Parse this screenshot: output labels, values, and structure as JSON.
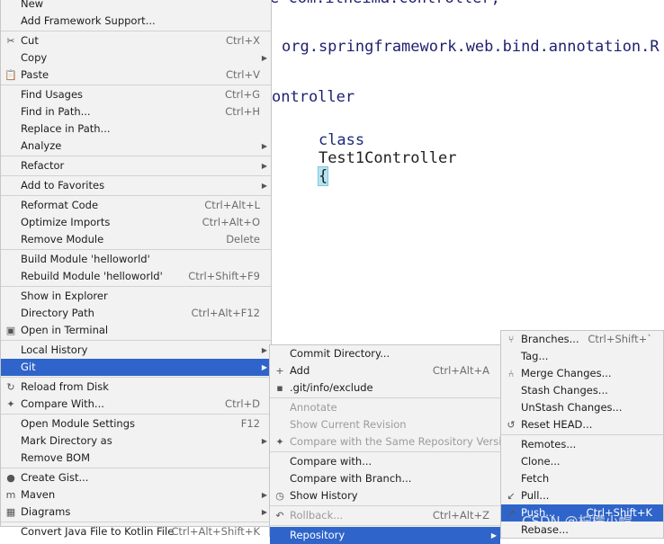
{
  "editor": {
    "line0": "e com.itheima.controller;",
    "line1": "org.springframework.web.bind.annotation.R",
    "line2": "ontroller",
    "line3_kw": "class",
    "line3_name": "Test1Controller",
    "line3_brace": "{"
  },
  "menu1": {
    "items": [
      {
        "label": "New",
        "shortcut": "",
        "arrow": "",
        "icon": ""
      },
      {
        "label": "Add Framework Support...",
        "shortcut": "",
        "arrow": "",
        "icon": ""
      },
      {
        "label": "Cut",
        "shortcut": "Ctrl+X",
        "arrow": "",
        "icon": "✂"
      },
      {
        "label": "Copy",
        "shortcut": "",
        "arrow": "▶",
        "icon": ""
      },
      {
        "label": "Paste",
        "shortcut": "Ctrl+V",
        "arrow": "",
        "icon": "📋"
      },
      {
        "label": "Find Usages",
        "shortcut": "Ctrl+G",
        "arrow": "",
        "icon": ""
      },
      {
        "label": "Find in Path...",
        "shortcut": "Ctrl+H",
        "arrow": "",
        "icon": ""
      },
      {
        "label": "Replace in Path...",
        "shortcut": "",
        "arrow": "",
        "icon": ""
      },
      {
        "label": "Analyze",
        "shortcut": "",
        "arrow": "▶",
        "icon": ""
      },
      {
        "label": "Refactor",
        "shortcut": "",
        "arrow": "▶",
        "icon": ""
      },
      {
        "label": "Add to Favorites",
        "shortcut": "",
        "arrow": "▶",
        "icon": ""
      },
      {
        "label": "Reformat Code",
        "shortcut": "Ctrl+Alt+L",
        "arrow": "",
        "icon": ""
      },
      {
        "label": "Optimize Imports",
        "shortcut": "Ctrl+Alt+O",
        "arrow": "",
        "icon": ""
      },
      {
        "label": "Remove Module",
        "shortcut": "Delete",
        "arrow": "",
        "icon": ""
      },
      {
        "label": "Build Module 'helloworld'",
        "shortcut": "",
        "arrow": "",
        "icon": ""
      },
      {
        "label": "Rebuild Module 'helloworld'",
        "shortcut": "Ctrl+Shift+F9",
        "arrow": "",
        "icon": ""
      },
      {
        "label": "Show in Explorer",
        "shortcut": "",
        "arrow": "",
        "icon": ""
      },
      {
        "label": "Directory Path",
        "shortcut": "Ctrl+Alt+F12",
        "arrow": "",
        "icon": ""
      },
      {
        "label": "Open in Terminal",
        "shortcut": "",
        "arrow": "",
        "icon": "▣"
      },
      {
        "label": "Local History",
        "shortcut": "",
        "arrow": "▶",
        "icon": ""
      },
      {
        "label": "Git",
        "shortcut": "",
        "arrow": "▶",
        "icon": ""
      },
      {
        "label": "Reload from Disk",
        "shortcut": "",
        "arrow": "",
        "icon": "↻"
      },
      {
        "label": "Compare With...",
        "shortcut": "Ctrl+D",
        "arrow": "",
        "icon": "✦"
      },
      {
        "label": "Open Module Settings",
        "shortcut": "F12",
        "arrow": "",
        "icon": ""
      },
      {
        "label": "Mark Directory as",
        "shortcut": "",
        "arrow": "▶",
        "icon": ""
      },
      {
        "label": "Remove BOM",
        "shortcut": "",
        "arrow": "",
        "icon": ""
      },
      {
        "label": "Create Gist...",
        "shortcut": "",
        "arrow": "",
        "icon": "●"
      },
      {
        "label": "Maven",
        "shortcut": "",
        "arrow": "▶",
        "icon": "m"
      },
      {
        "label": "Diagrams",
        "shortcut": "",
        "arrow": "▶",
        "icon": "▦"
      },
      {
        "label": "Convert Java File to Kotlin File",
        "shortcut": "Ctrl+Alt+Shift+K",
        "arrow": "",
        "icon": ""
      }
    ]
  },
  "menu2": {
    "items": [
      {
        "label": "Commit Directory...",
        "shortcut": "",
        "arrow": "",
        "icon": ""
      },
      {
        "label": "Add",
        "shortcut": "Ctrl+Alt+A",
        "arrow": "",
        "icon": "+"
      },
      {
        "label": ".git/info/exclude",
        "shortcut": "",
        "arrow": "",
        "icon": "▪"
      },
      {
        "label": "Annotate",
        "shortcut": "",
        "arrow": "",
        "icon": ""
      },
      {
        "label": "Show Current Revision",
        "shortcut": "",
        "arrow": "",
        "icon": ""
      },
      {
        "label": "Compare with the Same Repository Version",
        "shortcut": "",
        "arrow": "",
        "icon": "✦"
      },
      {
        "label": "Compare with...",
        "shortcut": "",
        "arrow": "",
        "icon": ""
      },
      {
        "label": "Compare with Branch...",
        "shortcut": "",
        "arrow": "",
        "icon": ""
      },
      {
        "label": "Show History",
        "shortcut": "",
        "arrow": "",
        "icon": "◷"
      },
      {
        "label": "Rollback...",
        "shortcut": "Ctrl+Alt+Z",
        "arrow": "",
        "icon": "↶"
      },
      {
        "label": "Repository",
        "shortcut": "",
        "arrow": "▶",
        "icon": ""
      }
    ]
  },
  "menu3": {
    "items": [
      {
        "label": "Branches...",
        "shortcut": "Ctrl+Shift+`",
        "arrow": "",
        "icon": "⑂"
      },
      {
        "label": "Tag...",
        "shortcut": "",
        "arrow": "",
        "icon": ""
      },
      {
        "label": "Merge Changes...",
        "shortcut": "",
        "arrow": "",
        "icon": "⑃"
      },
      {
        "label": "Stash Changes...",
        "shortcut": "",
        "arrow": "",
        "icon": ""
      },
      {
        "label": "UnStash Changes...",
        "shortcut": "",
        "arrow": "",
        "icon": ""
      },
      {
        "label": "Reset HEAD...",
        "shortcut": "",
        "arrow": "",
        "icon": "↺"
      },
      {
        "label": "Remotes...",
        "shortcut": "",
        "arrow": "",
        "icon": ""
      },
      {
        "label": "Clone...",
        "shortcut": "",
        "arrow": "",
        "icon": ""
      },
      {
        "label": "Fetch",
        "shortcut": "",
        "arrow": "",
        "icon": ""
      },
      {
        "label": "Pull...",
        "shortcut": "",
        "arrow": "",
        "icon": "↙"
      },
      {
        "label": "Push...",
        "shortcut": "Ctrl+Shift+K",
        "arrow": "",
        "icon": "↗"
      },
      {
        "label": "Rebase...",
        "shortcut": "",
        "arrow": "",
        "icon": ""
      }
    ]
  },
  "watermark": "CSDN @柠檬小帽"
}
